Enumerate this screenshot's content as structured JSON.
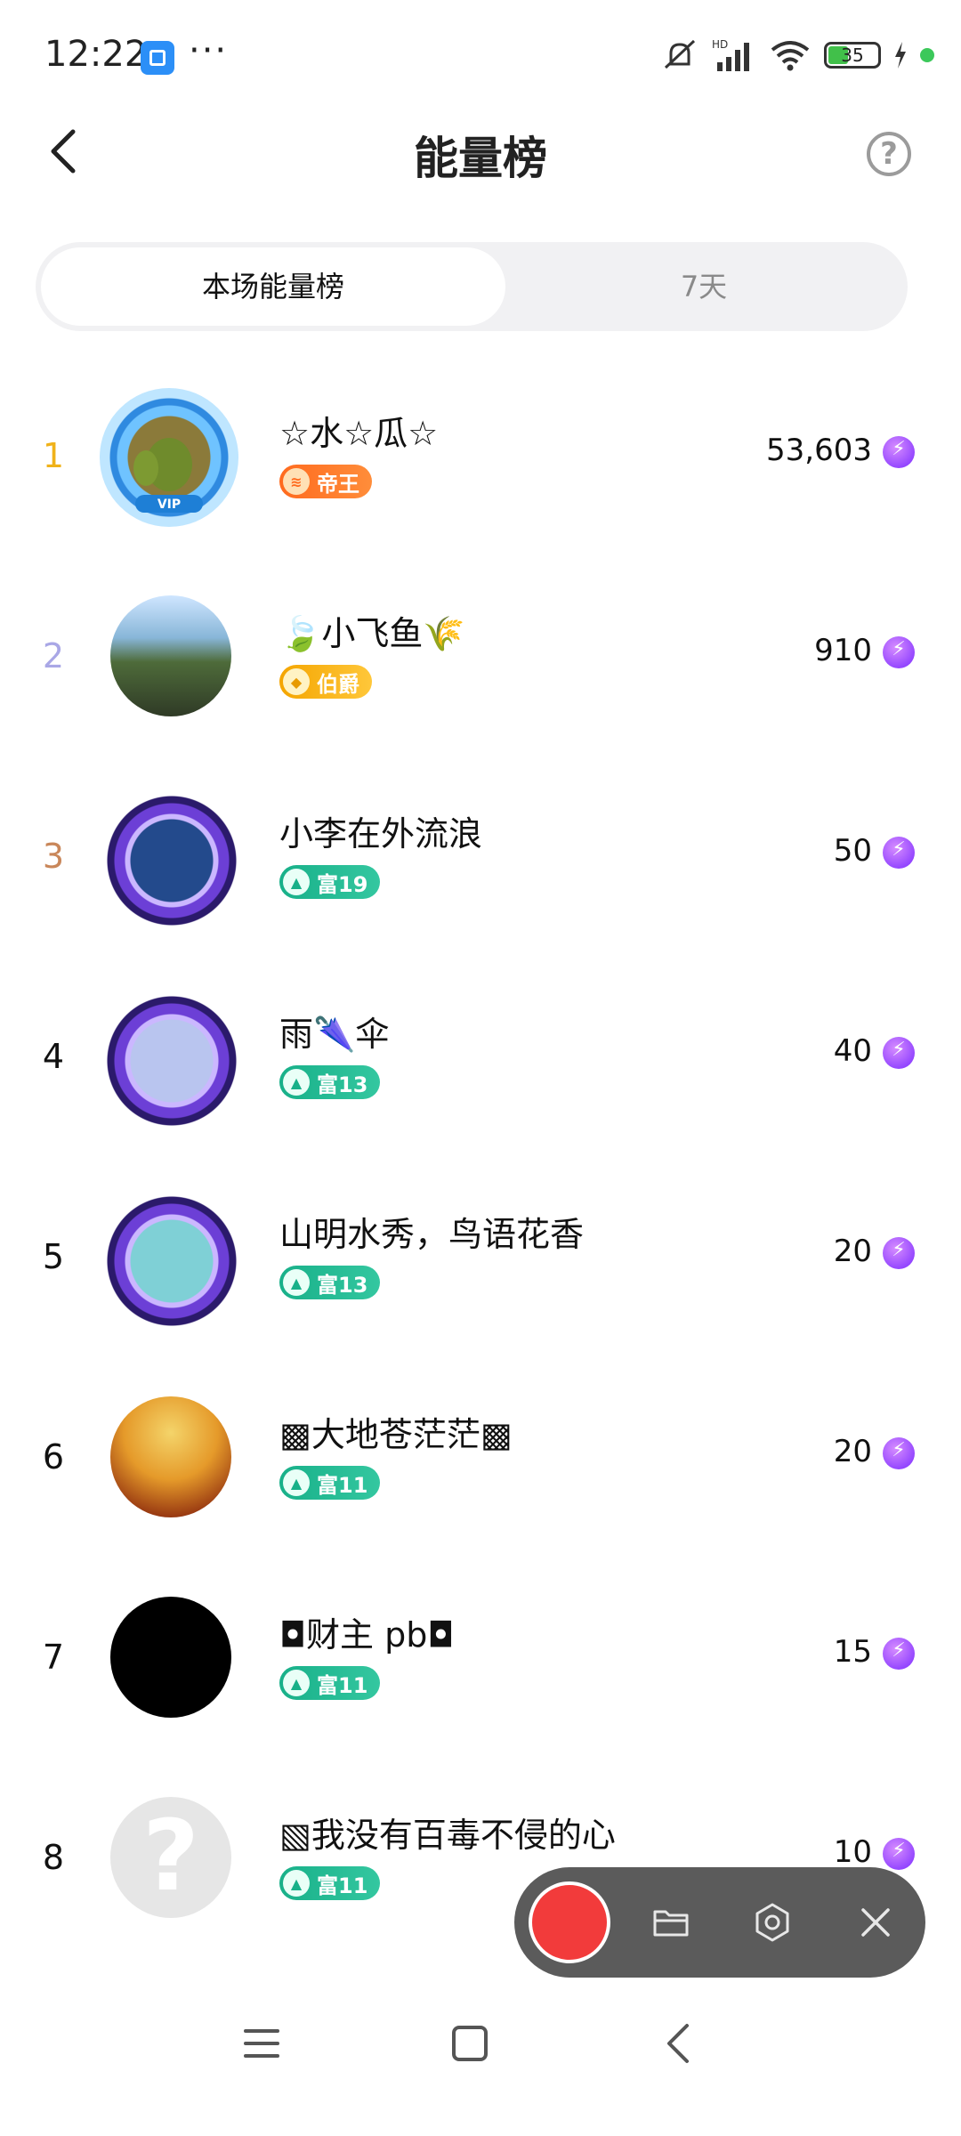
{
  "status_bar": {
    "time": "12:22",
    "more": "···",
    "battery": "35",
    "icons": [
      "app-icon",
      "mute-icon",
      "signal-icon",
      "wifi-icon",
      "battery-icon",
      "charging-icon"
    ]
  },
  "header": {
    "title": "能量榜",
    "back_icon": "chevron-left-icon",
    "help_label": "?"
  },
  "tabs": [
    {
      "label": "本场能量榜",
      "active": true
    },
    {
      "label": "7天",
      "active": false
    }
  ],
  "ranking": [
    {
      "rank": "1",
      "name": "☆水☆瓜☆",
      "badge": "帝王",
      "badge_type": "emperor",
      "score": "53,603",
      "rank_color": "#f0b21a"
    },
    {
      "rank": "2",
      "name": "🍃小飞鱼🌾",
      "badge": "伯爵",
      "badge_type": "earl",
      "score": "910",
      "rank_color": "#a9a7e6"
    },
    {
      "rank": "3",
      "name": "小李在外流浪",
      "badge": "富19",
      "badge_type": "rich",
      "score": "50",
      "rank_color": "#c9875a"
    },
    {
      "rank": "4",
      "name": "雨🌂伞",
      "badge": "富13",
      "badge_type": "rich",
      "score": "40",
      "rank_color": "#111111"
    },
    {
      "rank": "5",
      "name": "山明水秀，鸟语花香",
      "badge": "富13",
      "badge_type": "rich",
      "score": "20",
      "rank_color": "#111111"
    },
    {
      "rank": "6",
      "name": "▩大地苍茫茫▩",
      "badge": "富11",
      "badge_type": "rich",
      "score": "20",
      "rank_color": "#111111"
    },
    {
      "rank": "7",
      "name": "◘财主 pb◘",
      "badge": "富11",
      "badge_type": "rich",
      "score": "15",
      "rank_color": "#111111"
    },
    {
      "rank": "8",
      "name": "▧我没有百毒不侵的心",
      "badge": "富11",
      "badge_type": "rich",
      "score": "10",
      "rank_color": "#111111"
    }
  ],
  "recorder": {
    "icons": [
      "record-icon",
      "folder-icon",
      "settings-icon",
      "close-icon"
    ]
  },
  "nav": {
    "icons": [
      "menu-icon",
      "home-icon",
      "back-icon"
    ]
  },
  "colors": {
    "accent_purple": "#7b2cff",
    "rich_badge": "#18b089",
    "emperor_badge": "#ff6a1e",
    "earl_badge": "#f4a500"
  }
}
